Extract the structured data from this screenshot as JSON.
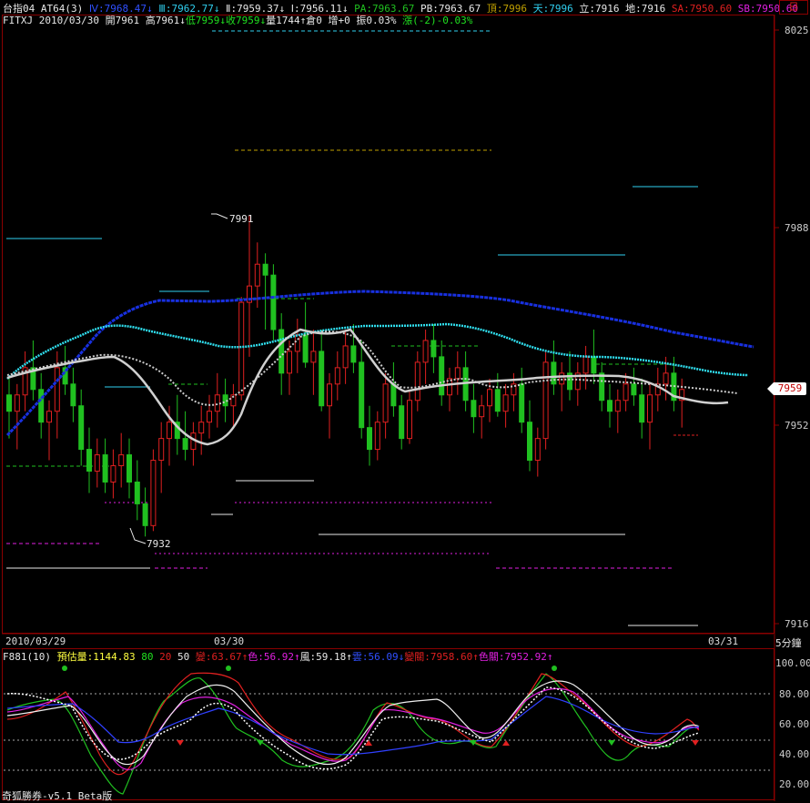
{
  "colors": {
    "up": "#e02020",
    "down": "#20c020",
    "frame": "#8a0000",
    "blue": "#1830e0",
    "cyan": "#30e0f0",
    "white": "#e0e0e0"
  },
  "header": {
    "row1": [
      {
        "text": "台指04",
        "color": "#e8e8e8"
      },
      {
        "text": " AT64(3)",
        "color": "#e8e8e8"
      },
      {
        "text": " Ⅳ:7968.47↓",
        "color": "#3050ff"
      },
      {
        "text": " Ⅲ:7962.77↓",
        "color": "#30d0f0"
      },
      {
        "text": " Ⅱ:7959.37↓",
        "color": "#e8e8e8"
      },
      {
        "text": " Ⅰ:7956.11↓",
        "color": "#e8e8e8"
      },
      {
        "text": " PA:7963.67",
        "color": "#20c020"
      },
      {
        "text": " PB:7963.67",
        "color": "#e8e8e8"
      },
      {
        "text": " 頂:7996",
        "color": "#c0a000"
      },
      {
        "text": " 天:7996",
        "color": "#30d0f0"
      },
      {
        "text": " 立:7916",
        "color": "#e8e8e8"
      },
      {
        "text": " 地:7916",
        "color": "#e8e8e8"
      },
      {
        "text": " SA:7950.60",
        "color": "#e02020"
      },
      {
        "text": " SB:7950.60",
        "color": "#e020e0"
      }
    ],
    "row2": [
      {
        "text": "FITXJ 2010/03/30 ",
        "color": "#e8e8e8"
      },
      {
        "text": "開7961 ",
        "color": "#e8e8e8"
      },
      {
        "text": "高7961↓",
        "color": "#e8e8e8"
      },
      {
        "text": "低7959↓",
        "color": "#20e020"
      },
      {
        "text": "收7959↓",
        "color": "#20e020"
      },
      {
        "text": "量1744↑",
        "color": "#e8e8e8"
      },
      {
        "text": "倉0 ",
        "color": "#e8e8e8"
      },
      {
        "text": "增+0 ",
        "color": "#e8e8e8"
      },
      {
        "text": "振0.03% ",
        "color": "#e8e8e8"
      },
      {
        "text": "漲(-2)-0.03%",
        "color": "#20e020"
      }
    ]
  },
  "corner_label": "日",
  "price_axis": [
    "8025",
    "7988",
    "7952",
    "7916"
  ],
  "current_price": "7959",
  "annotations": {
    "high": "7991",
    "low": "7932"
  },
  "period_label": "5分鐘",
  "date_labels": [
    "2010/03/29",
    "03/30",
    "03/31"
  ],
  "indicator": {
    "header": [
      {
        "text": "F881(10) ",
        "color": "#e8e8e8"
      },
      {
        "text": "預估量:1144.83 ",
        "color": "#ffff40"
      },
      {
        "text": "80 ",
        "color": "#20e020"
      },
      {
        "text": "20 ",
        "color": "#e02020"
      },
      {
        "text": "50 ",
        "color": "#e8e8e8"
      },
      {
        "text": "變:63.67↑",
        "color": "#e02020"
      },
      {
        "text": "色:56.92↑",
        "color": "#e020e0"
      },
      {
        "text": "風:59.18↑",
        "color": "#e8e8e8"
      },
      {
        "text": "雲:56.09↓",
        "color": "#3050ff"
      },
      {
        "text": "變關:7958.60↑",
        "color": "#e02020"
      },
      {
        "text": "色關:7952.92↑",
        "color": "#e020e0"
      }
    ],
    "axis": [
      "100.00",
      "80.00",
      "60.00",
      "40.00",
      "20.00"
    ]
  },
  "footer": "奇狐勝券-v5.1 Beta版",
  "chart_data": {
    "type": "candlestick",
    "ylim": [
      7910,
      8030
    ],
    "candles": [
      [
        7958,
        7961,
        7950,
        7955
      ],
      [
        7955,
        7960,
        7948,
        7958
      ],
      [
        7958,
        7966,
        7955,
        7963
      ],
      [
        7963,
        7968,
        7957,
        7959
      ],
      [
        7959,
        7962,
        7950,
        7953
      ],
      [
        7953,
        7957,
        7946,
        7955
      ],
      [
        7955,
        7966,
        7950,
        7963
      ],
      [
        7963,
        7967,
        7958,
        7960
      ],
      [
        7960,
        7963,
        7953,
        7956
      ],
      [
        7956,
        7959,
        7945,
        7948
      ],
      [
        7948,
        7952,
        7940,
        7944
      ],
      [
        7944,
        7950,
        7941,
        7947
      ],
      [
        7947,
        7950,
        7940,
        7942
      ],
      [
        7942,
        7948,
        7939,
        7945
      ],
      [
        7945,
        7951,
        7941,
        7947
      ],
      [
        7947,
        7950,
        7939,
        7942
      ],
      [
        7942,
        7946,
        7935,
        7938
      ],
      [
        7938,
        7941,
        7932,
        7934
      ],
      [
        7934,
        7948,
        7933,
        7946
      ],
      [
        7946,
        7953,
        7940,
        7950
      ],
      [
        7950,
        7956,
        7945,
        7953
      ],
      [
        7953,
        7958,
        7947,
        7950
      ],
      [
        7950,
        7955,
        7946,
        7948
      ],
      [
        7948,
        7953,
        7945,
        7951
      ],
      [
        7951,
        7956,
        7947,
        7953
      ],
      [
        7953,
        7958,
        7950,
        7955
      ],
      [
        7955,
        7962,
        7952,
        7958
      ],
      [
        7958,
        7961,
        7953,
        7956
      ],
      [
        7956,
        7960,
        7952,
        7958
      ],
      [
        7958,
        7976,
        7957,
        7975
      ],
      [
        7975,
        7991,
        7965,
        7978
      ],
      [
        7978,
        7986,
        7974,
        7982
      ],
      [
        7982,
        7984,
        7970,
        7980
      ],
      [
        7980,
        7982,
        7968,
        7970
      ],
      [
        7970,
        7973,
        7958,
        7962
      ],
      [
        7962,
        7968,
        7958,
        7966
      ],
      [
        7966,
        7972,
        7962,
        7969
      ],
      [
        7969,
        7975,
        7963,
        7964
      ],
      [
        7964,
        7970,
        7958,
        7966
      ],
      [
        7966,
        7970,
        7955,
        7956
      ],
      [
        7956,
        7962,
        7950,
        7960
      ],
      [
        7960,
        7966,
        7957,
        7963
      ],
      [
        7963,
        7970,
        7960,
        7967
      ],
      [
        7967,
        7971,
        7962,
        7964
      ],
      [
        7964,
        7968,
        7950,
        7952
      ],
      [
        7952,
        7956,
        7945,
        7948
      ],
      [
        7948,
        7955,
        7946,
        7953
      ],
      [
        7953,
        7962,
        7950,
        7960
      ],
      [
        7960,
        7964,
        7954,
        7956
      ],
      [
        7956,
        7958,
        7948,
        7950
      ],
      [
        7950,
        7959,
        7949,
        7957
      ],
      [
        7957,
        7966,
        7955,
        7964
      ],
      [
        7964,
        7970,
        7960,
        7968
      ],
      [
        7968,
        7971,
        7962,
        7965
      ],
      [
        7965,
        7968,
        7956,
        7958
      ],
      [
        7958,
        7963,
        7955,
        7961
      ],
      [
        7961,
        7966,
        7958,
        7963
      ],
      [
        7963,
        7966,
        7955,
        7957
      ],
      [
        7957,
        7960,
        7951,
        7954
      ],
      [
        7954,
        7958,
        7950,
        7956
      ],
      [
        7956,
        7961,
        7953,
        7959
      ],
      [
        7959,
        7962,
        7954,
        7955
      ],
      [
        7955,
        7960,
        7952,
        7958
      ],
      [
        7958,
        7962,
        7955,
        7960
      ],
      [
        7960,
        7963,
        7951,
        7953
      ],
      [
        7953,
        7957,
        7944,
        7946
      ],
      [
        7946,
        7952,
        7943,
        7950
      ],
      [
        7950,
        7966,
        7948,
        7964
      ],
      [
        7964,
        7968,
        7958,
        7960
      ],
      [
        7960,
        7964,
        7955,
        7962
      ],
      [
        7962,
        7966,
        7957,
        7959
      ],
      [
        7959,
        7964,
        7956,
        7962
      ],
      [
        7962,
        7967,
        7959,
        7965
      ],
      [
        7965,
        7970,
        7960,
        7962
      ],
      [
        7962,
        7964,
        7955,
        7957
      ],
      [
        7957,
        7960,
        7952,
        7955
      ],
      [
        7955,
        7959,
        7951,
        7957
      ],
      [
        7957,
        7962,
        7955,
        7960
      ],
      [
        7960,
        7963,
        7956,
        7958
      ],
      [
        7958,
        7961,
        7950,
        7953
      ],
      [
        7953,
        7960,
        7948,
        7958
      ],
      [
        7958,
        7963,
        7955,
        7960
      ],
      [
        7960,
        7965,
        7957,
        7962
      ],
      [
        7962,
        7965,
        7955,
        7957
      ],
      [
        7957,
        7961,
        7952,
        7959
      ]
    ]
  }
}
